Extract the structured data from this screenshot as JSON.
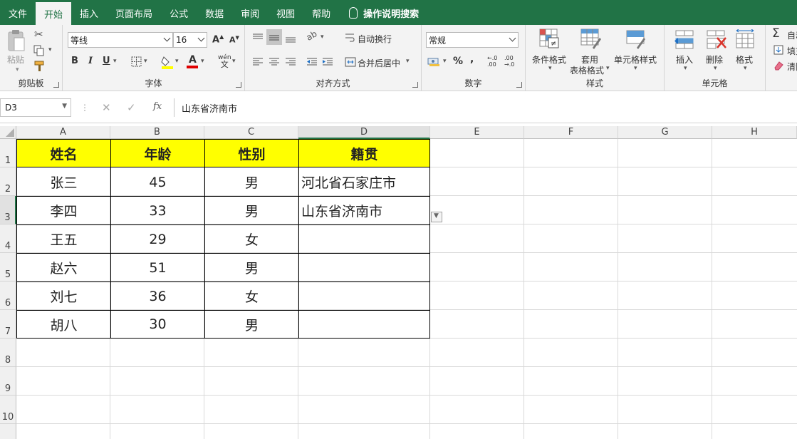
{
  "menu": {
    "tabs": [
      "文件",
      "开始",
      "插入",
      "页面布局",
      "公式",
      "数据",
      "审阅",
      "视图",
      "帮助"
    ],
    "active": "开始",
    "tell_me": "操作说明搜索"
  },
  "ribbon": {
    "clipboard": {
      "label": "剪贴板",
      "paste": "粘贴"
    },
    "font": {
      "label": "字体",
      "font_name": "等线",
      "font_size": "16"
    },
    "alignment": {
      "label": "对齐方式",
      "wrap": "自动换行",
      "merge": "合并后居中"
    },
    "number": {
      "label": "数字",
      "format": "常规",
      "percent": "%",
      "comma": ","
    },
    "styles": {
      "label": "样式",
      "conditional": "条件格式",
      "table_format_1": "套用",
      "table_format_2": "表格格式",
      "cell_styles": "单元格样式"
    },
    "cells": {
      "label": "单元格",
      "insert": "插入",
      "delete": "删除",
      "format": "格式"
    },
    "editing": {
      "autosum": "自动",
      "fill": "填充",
      "clear": "清除"
    }
  },
  "formula_bar": {
    "name_box": "D3",
    "fx": "fx",
    "value": "山东省济南市"
  },
  "sheet": {
    "columns": [
      "A",
      "B",
      "C",
      "D",
      "E",
      "F",
      "G",
      "H"
    ],
    "rows": [
      "1",
      "2",
      "3",
      "4",
      "5",
      "6",
      "7",
      "8",
      "9",
      "10"
    ],
    "header": [
      "姓名",
      "年龄",
      "性别",
      "籍贯"
    ],
    "data": [
      [
        "张三",
        "45",
        "男",
        "河北省石家庄市"
      ],
      [
        "李四",
        "33",
        "男",
        "山东省济南市"
      ],
      [
        "王五",
        "29",
        "女",
        ""
      ],
      [
        "赵六",
        "51",
        "男",
        ""
      ],
      [
        "刘七",
        "36",
        "女",
        ""
      ],
      [
        "胡八",
        "30",
        "男",
        ""
      ]
    ]
  },
  "colors": {
    "accent": "#217346",
    "header_fill": "#ffff00"
  }
}
